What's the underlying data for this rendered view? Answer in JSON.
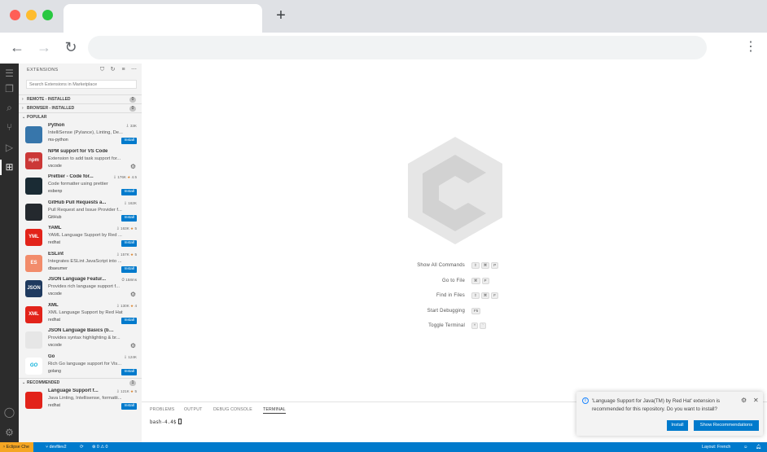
{
  "browser": {
    "new_tab_label": "+",
    "back_label": "←",
    "forward_label": "→",
    "reload_label": "↻",
    "menu_label": "⋮"
  },
  "sidebar": {
    "title": "EXTENSIONS",
    "search_placeholder": "Search Extensions in Marketplace",
    "sections": {
      "remote": {
        "label": "REMOTE - INSTALLED",
        "count": "0"
      },
      "browser": {
        "label": "BROWSER - INSTALLED",
        "count": "0"
      },
      "popular": {
        "label": "POPULAR"
      },
      "recommended": {
        "label": "RECOMMENDED",
        "count": "1"
      }
    },
    "popular": [
      {
        "name": "Python",
        "stats": "33K",
        "rating": "",
        "desc": "IntelliSense (Pylance), Linting, De...",
        "publisher": "ms-python",
        "action": "Install",
        "icon_text": "",
        "icon_color": "#3776ab"
      },
      {
        "name": "NPM support for VS Code",
        "stats": "",
        "rating": "",
        "desc": "Extension to add task support for...",
        "publisher": "vscode",
        "action": "gear",
        "icon_text": "npm",
        "icon_color": "#cb3837"
      },
      {
        "name": "Prettier - Code for...",
        "stats": "176K",
        "rating": "4.5",
        "desc": "Code formatter using prettier",
        "publisher": "esbenp",
        "action": "Install",
        "icon_text": "",
        "icon_color": "#1a2b34"
      },
      {
        "name": "GitHub Pull Requests a...",
        "stats": "162K",
        "rating": "",
        "desc": "Pull Request and Issue Provider f...",
        "publisher": "GitHub",
        "action": "Install",
        "icon_text": "",
        "icon_color": "#24292e"
      },
      {
        "name": "YAML",
        "stats": "163K",
        "rating": "5",
        "desc": "YAML Language Support by Red ...",
        "publisher": "redhat",
        "action": "Install",
        "icon_text": "YML",
        "icon_color": "#e2231a"
      },
      {
        "name": "ESLint",
        "stats": "157K",
        "rating": "5",
        "desc": "Integrates ESLint JavaScript into ...",
        "publisher": "dbaeumer",
        "action": "Install",
        "icon_text": "ES",
        "icon_color": "#f28c6b"
      },
      {
        "name": "JSON Language Featur...",
        "stats": "158ms",
        "rating": "",
        "desc": "Provides rich language support f...",
        "publisher": "vscode",
        "action": "gear",
        "icon_text": "JSON",
        "icon_color": "#1f3a5f"
      },
      {
        "name": "XML",
        "stats": "130K",
        "rating": "4",
        "desc": "XML Language Support by Red Hat",
        "publisher": "redhat",
        "action": "Install",
        "icon_text": "XML",
        "icon_color": "#e2231a"
      },
      {
        "name": "JSON Language Basics (built-in)",
        "stats": "",
        "rating": "",
        "desc": "Provides syntax highlighting & br...",
        "publisher": "vscode",
        "action": "gear",
        "icon_text": "",
        "icon_color": "#e6e6e6"
      },
      {
        "name": "Go",
        "stats": "124K",
        "rating": "",
        "desc": "Rich Go language support for Vis...",
        "publisher": "golang",
        "action": "Install",
        "icon_text": "GO",
        "icon_color": "#ffffff"
      }
    ],
    "recommended": [
      {
        "name": "Language Support f...",
        "stats": "121K",
        "rating": "5",
        "desc": "Java Linting, Intellisense, formatti...",
        "publisher": "redhat",
        "action": "Install",
        "icon_text": "",
        "icon_color": "#e2231a"
      }
    ]
  },
  "commands": [
    {
      "label": "Show All Commands",
      "keys": [
        "⇧",
        "⌘",
        "P"
      ]
    },
    {
      "label": "Go to File",
      "keys": [
        "⌘",
        "P"
      ]
    },
    {
      "label": "Find in Files",
      "keys": [
        "⇧",
        "⌘",
        "F"
      ]
    },
    {
      "label": "Start Debugging",
      "keys": [
        "F5"
      ]
    },
    {
      "label": "Toggle Terminal",
      "keys": [
        "^",
        "`"
      ]
    }
  ],
  "panel": {
    "tabs": [
      "PROBLEMS",
      "OUTPUT",
      "DEBUG CONSOLE",
      "TERMINAL"
    ],
    "active_tab": "TERMINAL",
    "prompt": "bash-4.4$"
  },
  "notification": {
    "message": "'Language Support for Java(TM) by Red Hat' extension is recommended for this repository. Do you want to install?",
    "install_label": "Install",
    "show_label": "Show Recommendations"
  },
  "statusbar": {
    "che_label": "Eclipse Che",
    "branch": "devfilev2",
    "problems": "0 ⚠ 0",
    "layout": "Layout: French"
  },
  "colors": {
    "accent": "#007acc",
    "che": "#f5a623",
    "activity_bar": "#2c2c2c",
    "sidebar": "#f3f3f3"
  }
}
